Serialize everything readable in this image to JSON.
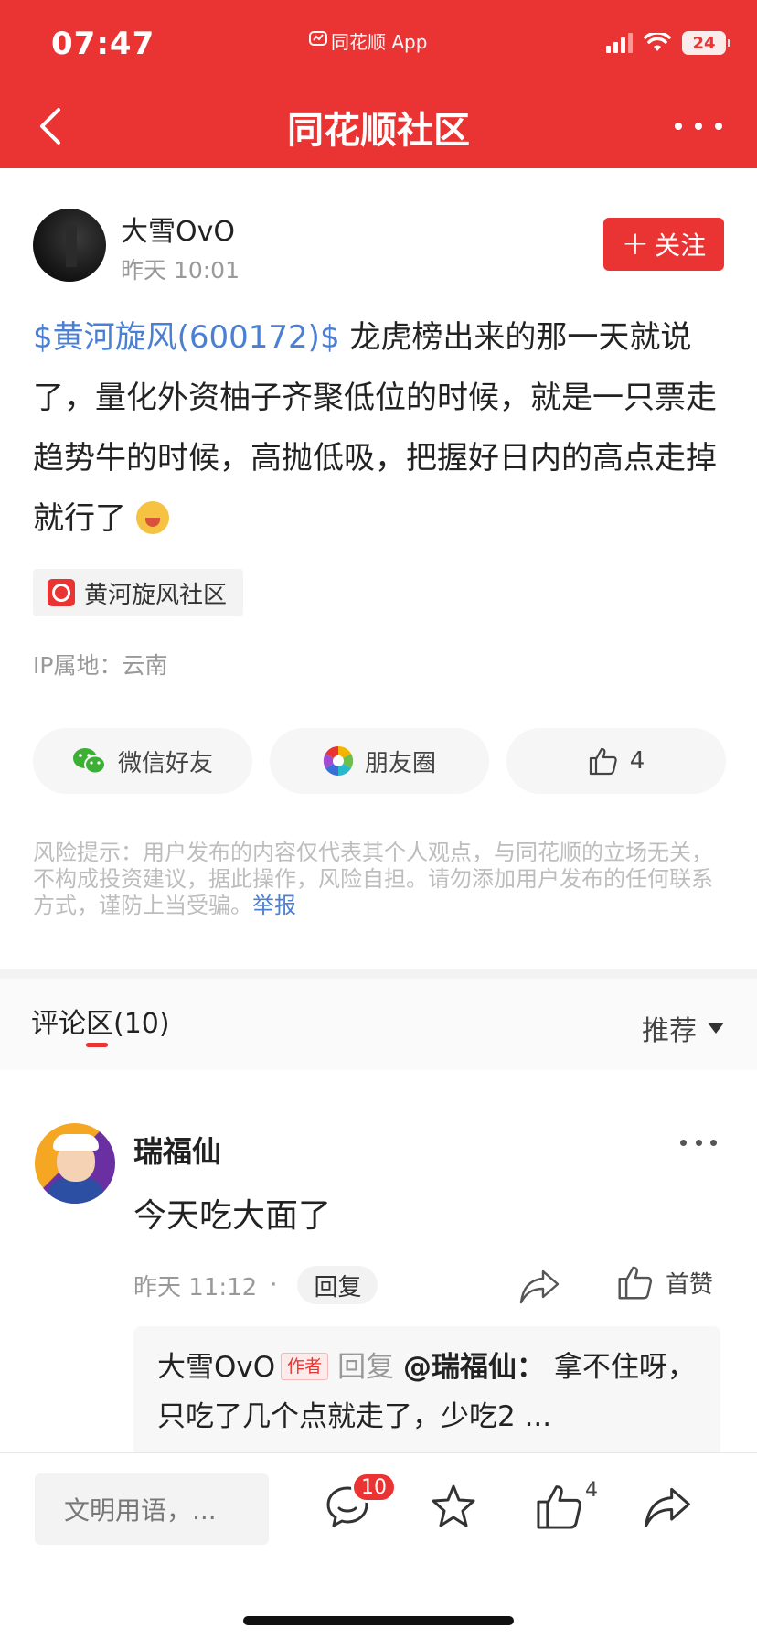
{
  "status_bar": {
    "time": "07:47",
    "app_label": "同花顺 App",
    "battery": "24"
  },
  "nav": {
    "title": "同花顺社区"
  },
  "post": {
    "author": "大雪OvO",
    "time": "昨天 10:01",
    "follow_label": "关注",
    "stock_link": "$黄河旋风(600172)$",
    "text": " 龙虎榜出来的那一天就说了，量化外资柚子齐聚低位的时候，就是一只票走趋势牛的时候，高抛低吸，把握好日内的高点走掉就行了",
    "emoji": "laughing-emoji",
    "community_tag": "黄河旋风社区",
    "ip_location": "IP属地：云南"
  },
  "share": {
    "wechat_label": "微信好友",
    "moments_label": "朋友圈",
    "like_count": "4"
  },
  "risk": {
    "text": "风险提示：用户发布的内容仅代表其个人观点，与同花顺的立场无关，不构成投资建议，据此操作，风险自担。请勿添加用户发布的任何联系方式，谨防上当受骗。",
    "report_label": "举报"
  },
  "comments_section": {
    "title": "评论区(10)",
    "sort_label": "推荐"
  },
  "comment": {
    "author": "瑞福仙",
    "text": "今天吃大面了",
    "time": "昨天 11:12",
    "separator": "·",
    "reply_label": "回复",
    "like_label": "首赞"
  },
  "reply": {
    "author": "大雪OvO",
    "badge": "作者",
    "reply_word": "回复",
    "target": "@瑞福仙：",
    "text": " 拿不住呀，只吃了几个点就走了，少吃2 ..."
  },
  "bottom_bar": {
    "input_placeholder": "文明用语，...",
    "comment_count": "10",
    "like_count": "4"
  },
  "colors": {
    "brand_red": "#ea3433",
    "link_blue": "#4a7fd1"
  }
}
